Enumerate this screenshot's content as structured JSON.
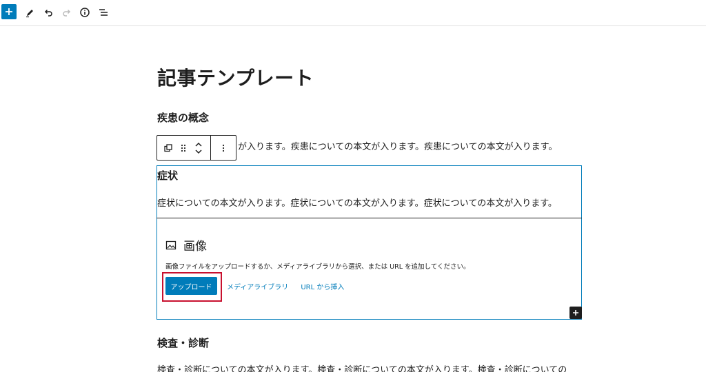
{
  "toolbar": {
    "add_icon": "plus-icon",
    "edit_icon": "pencil-icon",
    "undo_icon": "undo-icon",
    "redo_icon": "redo-icon",
    "info_icon": "info-icon",
    "list_view_icon": "list-view-icon",
    "accent_color": "#007cba"
  },
  "post": {
    "title": "記事テンプレート",
    "sections": [
      {
        "heading": "疾患の概念",
        "paragraph_visible": "が入ります。疾患についての本文が入ります。疾患についての本文が入ります。"
      },
      {
        "heading": "症状",
        "paragraph": "症状についての本文が入ります。症状についての本文が入ります。症状についての本文が入ります。"
      },
      {
        "heading": "検査・診断",
        "paragraph": "検査・診断についての本文が入ります。検査・診断についての本文が入ります。検査・診断についての"
      }
    ]
  },
  "block_toolbar": {
    "transform_icon": "copy-icon",
    "drag_icon": "drag-handle-icon",
    "move_icon": "chevron-up-down-icon",
    "options_icon": "more-vertical-icon"
  },
  "image_block": {
    "icon": "image-icon",
    "label": "画像",
    "instructions": "画像ファイルをアップロードするか、メディアライブラリから選択、または URL を追加してください。",
    "upload_label": "アップロード",
    "media_library_label": "メディアライブラリ",
    "insert_url_label": "URL から挿入"
  },
  "inserter": {
    "icon": "plus-icon"
  },
  "highlight_color": "#c8102e"
}
